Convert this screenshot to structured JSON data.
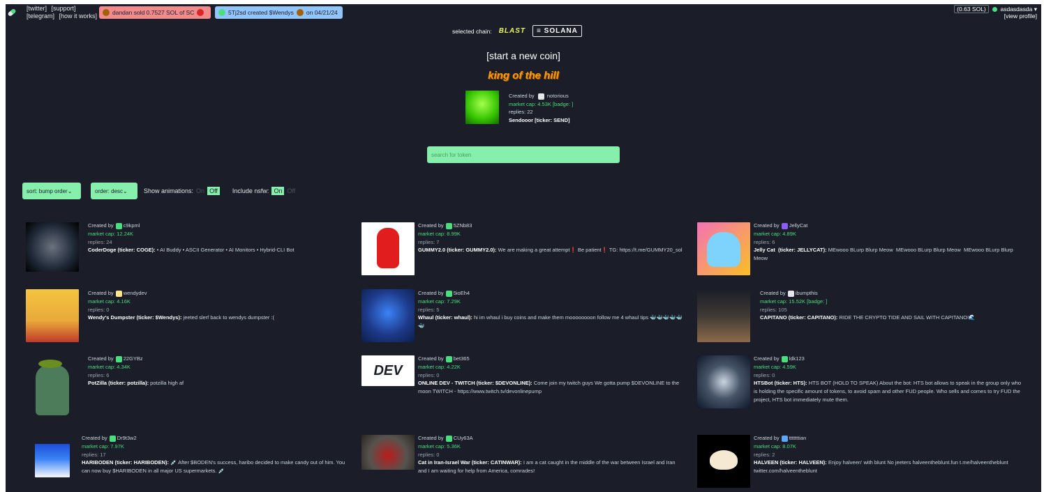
{
  "header": {
    "links": [
      "[twitter]",
      "[support]",
      "[telegram]",
      "[how it works]"
    ],
    "ticker_sold": "dandan  sold 0.7527 SOL of SC",
    "ticker_created": "5Tj2sd created $Wendys",
    "ticker_created_date": "on 04/21/24",
    "sol_balance": "(0.63 SOL)",
    "username": "asdasdasda",
    "view_profile": "[view profile]"
  },
  "chain": {
    "label": "selected chain:",
    "blast": "BLAST",
    "solana": "SOLANA"
  },
  "start_coin": "[start a new coin]",
  "king_of_hill": {
    "title": "king of the hill",
    "created_by_label": "Created by",
    "creator": "notorious",
    "market_cap": "market cap: 4.53K",
    "badge": "[badge: ]",
    "replies": "replies: 22",
    "name": "Sendooor [ticker: SEND]"
  },
  "search": {
    "placeholder": "search for token"
  },
  "controls": {
    "sort": "sort: bump order",
    "order": "order: desc",
    "animations_label": "Show animations:",
    "animations_on": "On",
    "animations_off": "Off",
    "nsfw_label": "Include nsfw:",
    "nsfw_on": "On",
    "nsfw_off": "Off"
  },
  "created_by_label": "Created by",
  "coins": [
    {
      "creator": "c9kpml",
      "mcap": "market cap: 12.24K",
      "replies": "replies: 24",
      "badge": "",
      "name": "CoderDoge (ticker: COGE):",
      "desc": " • AI Buddy • ASCII Generator • AI Monitors • Hybrid-CLI Bot"
    },
    {
      "creator": "5ZNb83",
      "mcap": "market cap: 8.99K",
      "replies": "replies: 7",
      "badge": "",
      "name": "GUMMY2.0 (ticker: GUMMY2.0):",
      "desc": " We are making a great attempt❗ Be patient❗ TG: https://t.me/GUMMY20_sol"
    },
    {
      "creator": "JellyCat",
      "mcap": "market cap: 4.89K",
      "replies": "replies: 6",
      "badge": "",
      "name": "Jelly Cat 󠀠󠀠 (ticker: JELLYCAT):",
      "desc": " MEwooo BLurp Blurp Meow 󠀠󠀠 MEwooo BLurp Blurp Meow 󠀠󠀠 MEwooo BLurp Blurp Meow 󠀠󠀠"
    },
    {
      "creator": "wendydev",
      "mcap": "market cap: 4.16K",
      "replies": "replies: 0",
      "badge": "",
      "name": "Wendy's Dumpster (ticker: $Wendys):",
      "desc": " jeeted slerf back to wendys dumpster :("
    },
    {
      "creator": "5ioEh4",
      "mcap": "market cap: 7.29K",
      "replies": "replies: 5",
      "badge": "",
      "name": "Whaul (ticker: whaul):",
      "desc": " hi im whaul i buy coins and make them moooooooon follow me 4 whaul tips 🐳🐳🐳🐳🐳🐳"
    },
    {
      "creator": "ibumpthis",
      "mcap": "market cap: 15.52K",
      "replies": "replies: 105",
      "badge": "[badge: ]",
      "name": "CAPITANO (ticker: CAPITANO):",
      "desc": " RIDE THE CRYPTO TIDE AND SAIL WITH CAPITANO!🌊"
    },
    {
      "creator": "22GYBz",
      "mcap": "market cap: 4.34K",
      "replies": "replies: 6",
      "badge": "",
      "name": "PotZilla (ticker: potzilla):",
      "desc": " potzilla high af"
    },
    {
      "creator": "bet365",
      "mcap": "market cap: 4.22K",
      "replies": "replies: 0",
      "badge": "",
      "name": "ONLINE DEV - TWITCH (ticker: $DEVONLINE):",
      "desc": " Come join my twitch guys We gotta pump $DEVONLINE to the moon TWITCH - https://www.twitch.tv/devonlinepump"
    },
    {
      "creator": "ldk123",
      "mcap": "market cap: 4.59K",
      "replies": "replies: 0",
      "badge": "",
      "name": "HTSBot (ticker: HTS):",
      "desc": " HTS BOT (HOLD TO SPEAK) About the bot: HTS bot allows to speak in the group only who is holding the specific amount of tokens, to avoid spam and other FUD people. Who sells and comes to try FUD the project, HTS bot immediately mute them."
    },
    {
      "creator": "Dr9t3w2",
      "mcap": "market cap: 7.97K",
      "replies": "replies: 17",
      "badge": "",
      "name": "HARIBODEN (ticker: HARIBODEN):",
      "desc": " 💉 After $BODEN's success, haribo decided to make candy out of him. You can now buy $HARIBODEN in all major US supermarkets. 💉"
    },
    {
      "creator": "CUy63A",
      "mcap": "market cap: 5.36K",
      "replies": "replies: 0",
      "badge": "",
      "name": "Cat in Iran-Israel War (ticker: CATINWAR):",
      "desc": " I am a cat caught in the middle of the war between Israel and Iran and I am waiting for help from America, comrades!"
    },
    {
      "creator": "tttttttian",
      "mcap": "market cap: 8.07K",
      "replies": "replies: 2",
      "badge": "",
      "name": "HALVEEN (ticker: HALVEEN):",
      "desc": " Enjoy halveen' with blunt No jeeters halveentheblunt.fun t.me/halveentheblunt twitter.com/halveentheblunt"
    }
  ],
  "colors": {
    "background": "#1b1d28",
    "accent_green": "#86efac",
    "text_green": "#4ade80",
    "ticker_red": "#f28b8b",
    "ticker_blue": "#93c5fd",
    "koth_orange": "#f59e0b"
  },
  "icons": [
    "pill-logo-icon",
    "chevron-down-icon",
    "user-avatar-icon",
    "badge-icon"
  ]
}
